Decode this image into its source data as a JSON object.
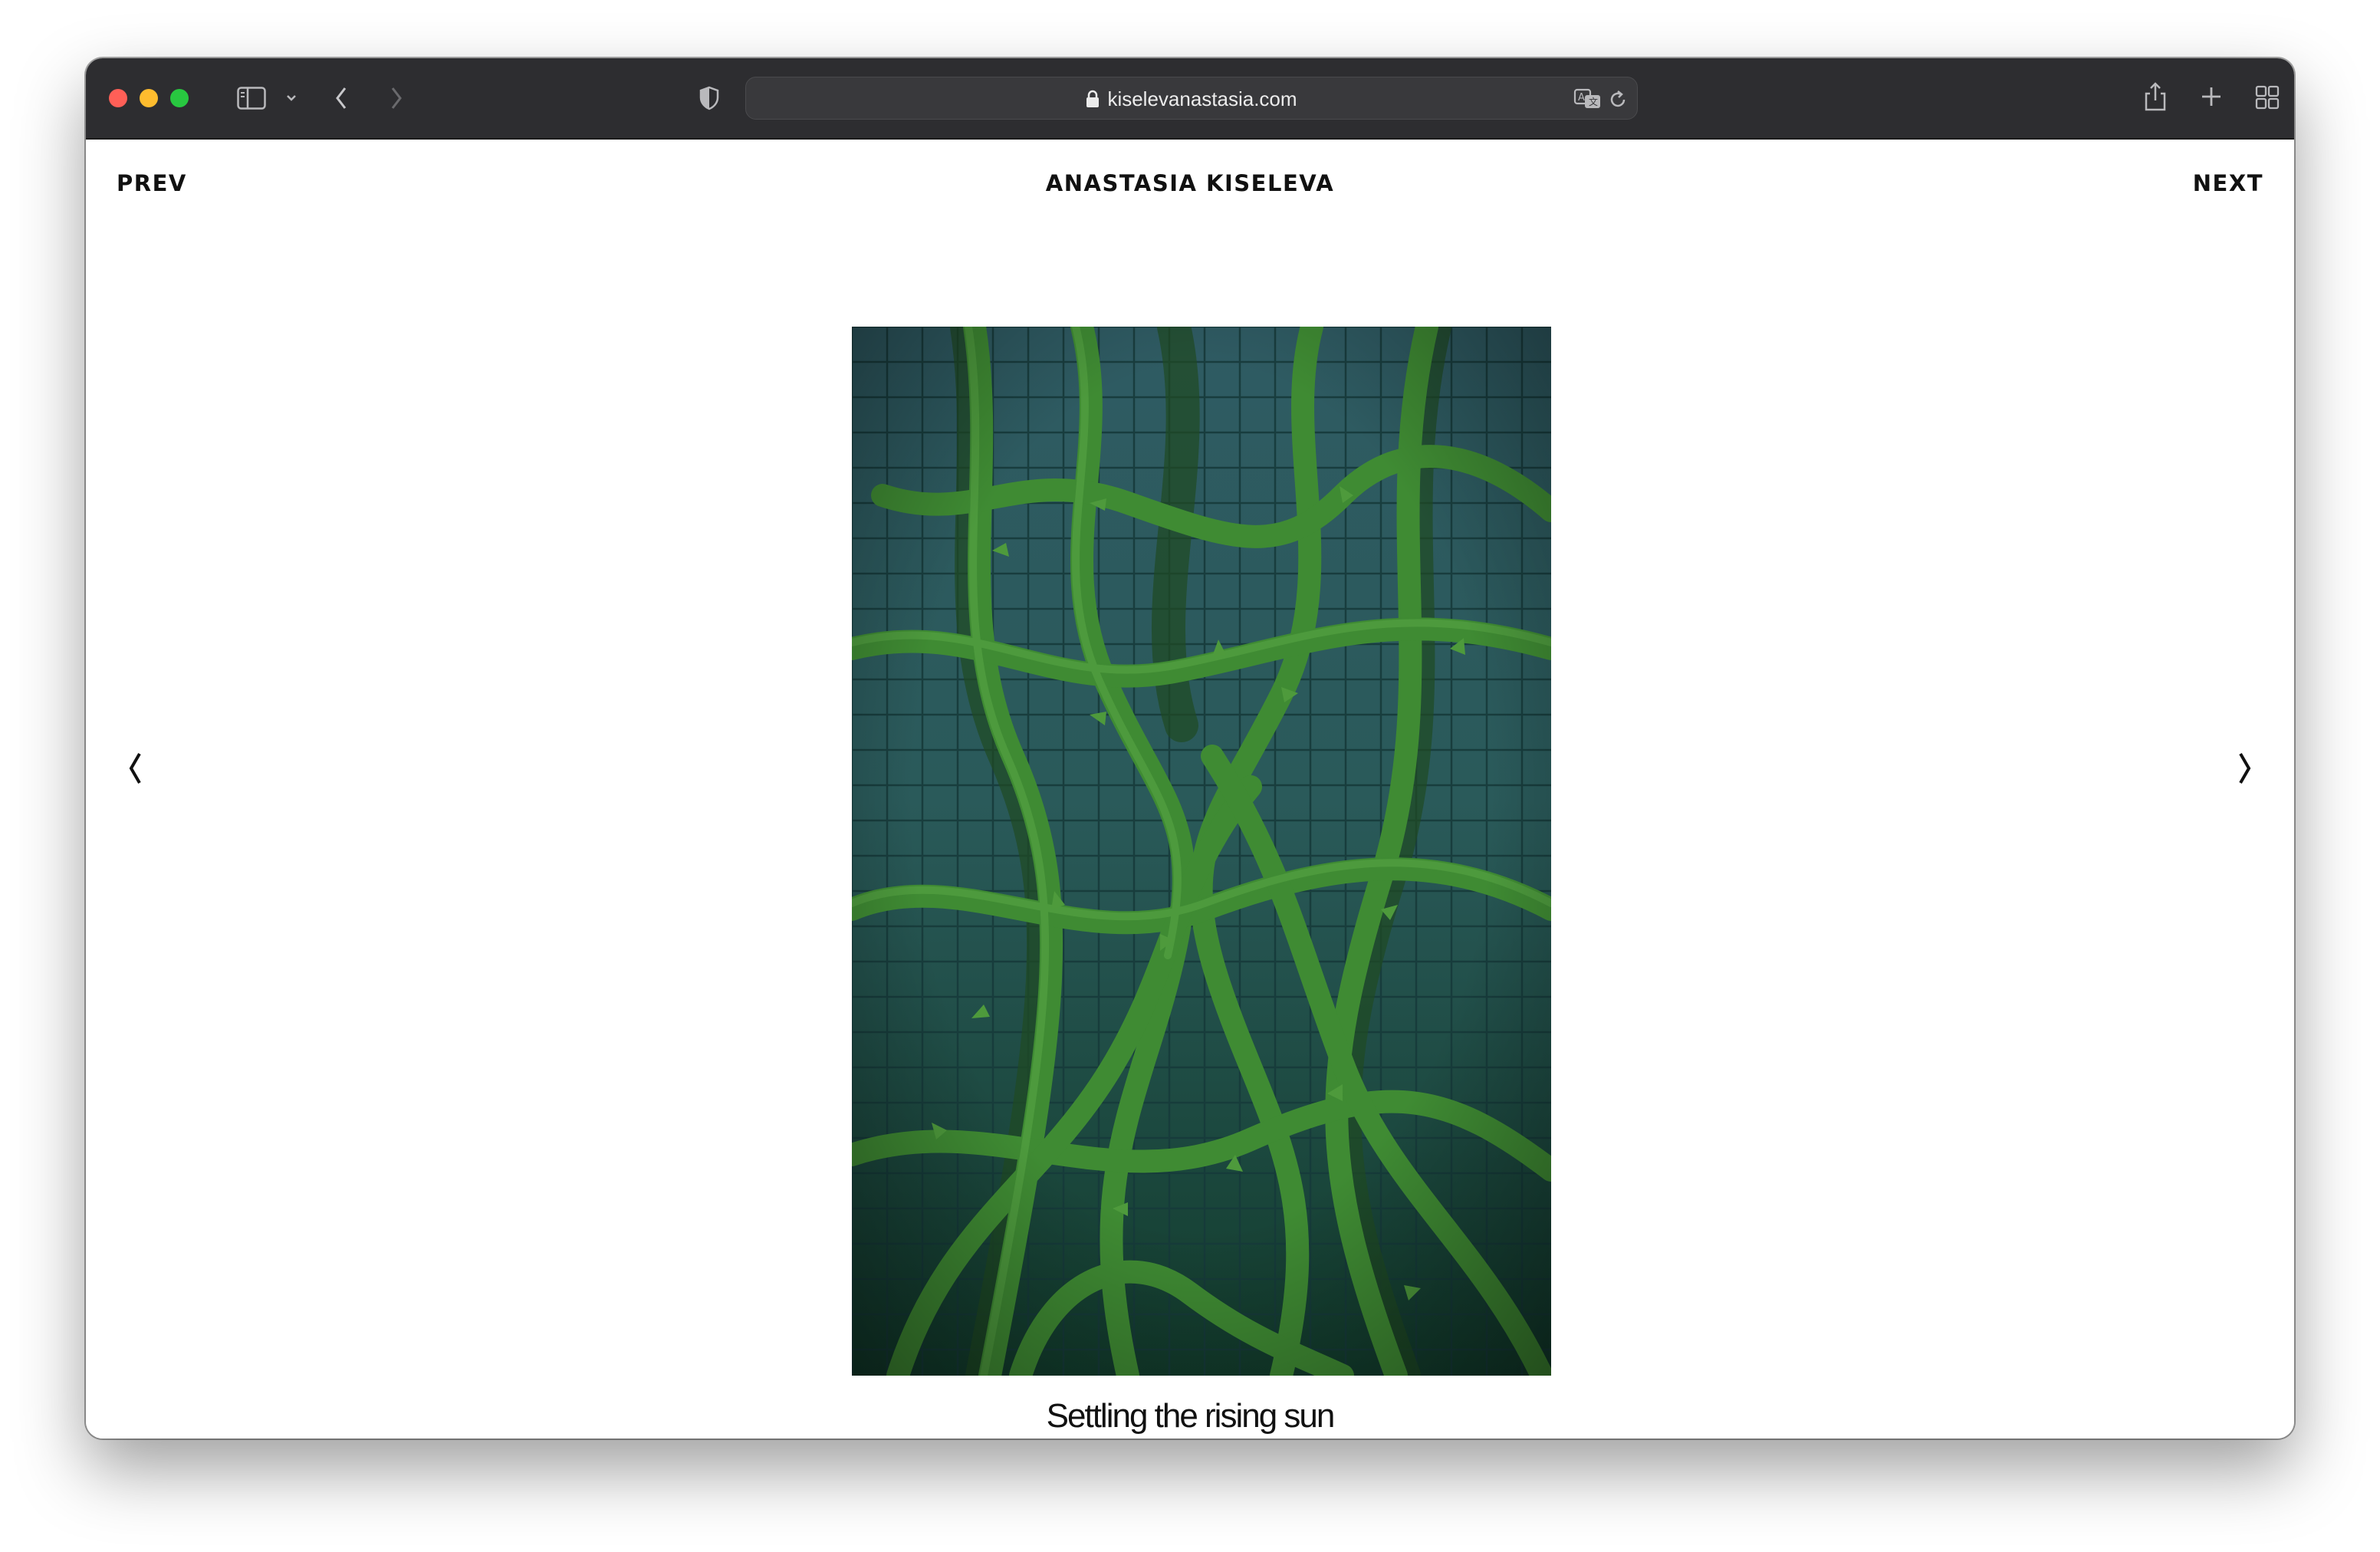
{
  "browser": {
    "url": "kiselevanastasia.com",
    "traffic_lights": {
      "close": "#ff5f57",
      "minimize": "#febc2e",
      "zoom": "#28c840"
    },
    "icons": {
      "sidebar": "sidebar-icon",
      "chevron": "chevron-down-icon",
      "back": "back-icon",
      "forward": "forward-icon",
      "shield": "shield-icon",
      "lock": "lock-icon",
      "translate": "translate-icon",
      "reload": "reload-icon",
      "share": "share-icon",
      "new_tab": "plus-icon",
      "tab_overview": "tab-overview-icon"
    }
  },
  "page": {
    "prev_label": "PREV",
    "next_label": "NEXT",
    "site_title": "ANASTASIA KISELEVA",
    "left_arrow": "❬",
    "right_arrow": "❭",
    "artwork_caption": "Settling the rising sun",
    "colors": {
      "artwork_background": "#1d4a3c",
      "thorn_green": "#3e8a32"
    }
  }
}
